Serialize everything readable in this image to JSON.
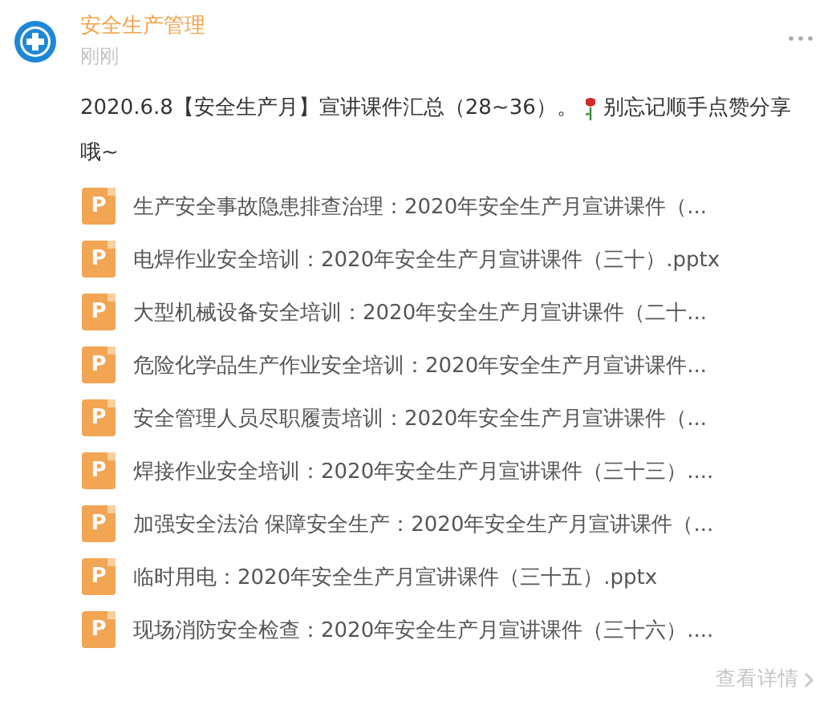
{
  "post": {
    "author": "安全生产管理",
    "time": "刚刚",
    "caption_before": "2020.6.8【安全生产月】宣讲课件汇总（28~36）。",
    "caption_after": "别忘记顺手点赞分享",
    "caption_end": "哦~"
  },
  "files": [
    {
      "icon_letter": "P",
      "name": "生产安全事故隐患排查治理：2020年安全生产月宣讲课件（..."
    },
    {
      "icon_letter": "P",
      "name": "电焊作业安全培训：2020年安全生产月宣讲课件（三十）.pptx"
    },
    {
      "icon_letter": "P",
      "name": "大型机械设备安全培训：2020年安全生产月宣讲课件（二十..."
    },
    {
      "icon_letter": "P",
      "name": "危险化学品生产作业安全培训：2020年安全生产月宣讲课件..."
    },
    {
      "icon_letter": "P",
      "name": "安全管理人员尽职履责培训：2020年安全生产月宣讲课件（..."
    },
    {
      "icon_letter": "P",
      "name": "焊接作业安全培训：2020年安全生产月宣讲课件（三十三）...."
    },
    {
      "icon_letter": "P",
      "name": "加强安全法治 保障安全生产：2020年安全生产月宣讲课件（..."
    },
    {
      "icon_letter": "P",
      "name": "临时用电：2020年安全生产月宣讲课件（三十五）.pptx"
    },
    {
      "icon_letter": "P",
      "name": "现场消防安全检查：2020年安全生产月宣讲课件（三十六）...."
    }
  ],
  "footer": {
    "details_link": "查看详情"
  }
}
